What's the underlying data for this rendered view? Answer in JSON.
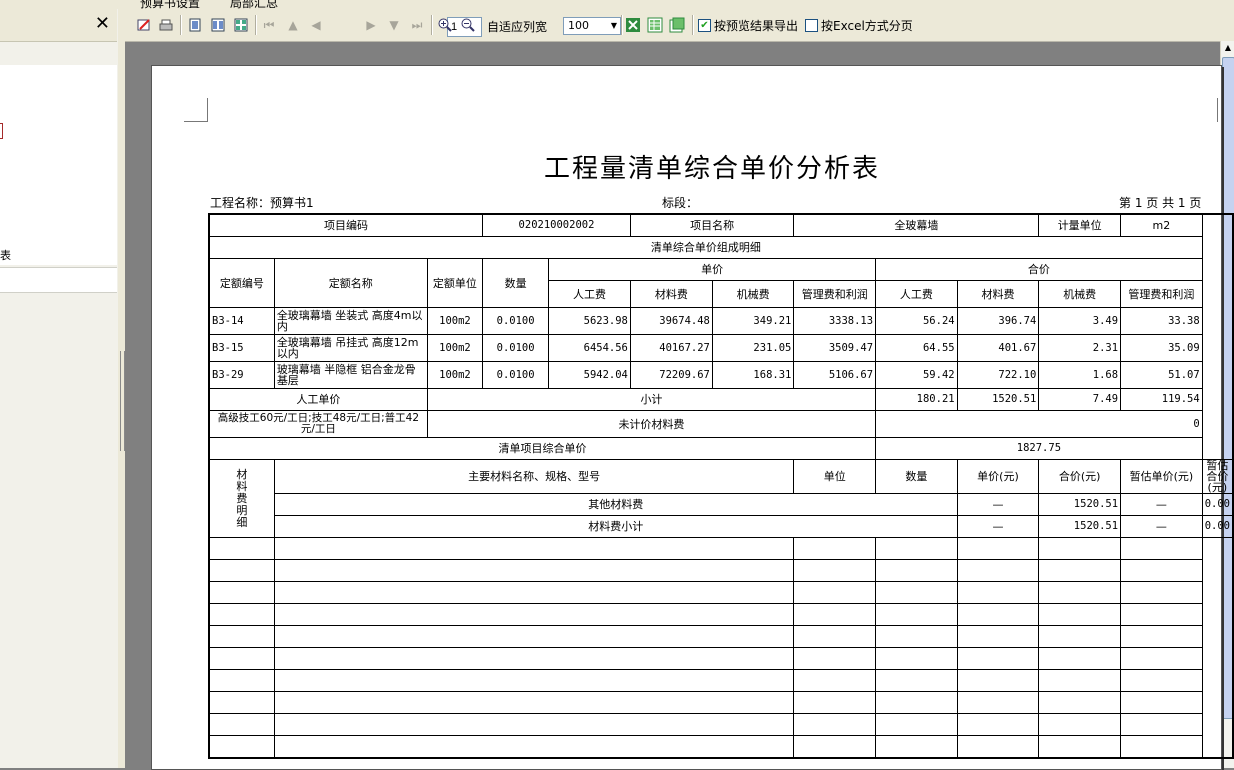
{
  "top_strip": {
    "item1": "预算书设置",
    "item2": "局部汇总"
  },
  "toolbar": {
    "page_number": "1",
    "fit_width_label": "自适应列宽",
    "zoom_value": "100",
    "export_preview_label": "按预览结果导出",
    "excel_paging_label": "按Excel方式分页",
    "export_preview_checked": true,
    "excel_paging_checked": false,
    "icons": [
      "edit-icon",
      "print-icon",
      "single-page-icon",
      "two-page-icon",
      "multi-page-icon",
      "first-page-icon",
      "prev-section-icon",
      "prev-page-icon",
      "next-page-icon",
      "next-section-icon",
      "last-page-icon",
      "zoom-in-icon",
      "zoom-out-icon",
      "excel-export-icon",
      "excel-sheet-icon",
      "excel-multi-icon"
    ]
  },
  "left_panel": {
    "close_label": "✕",
    "item_text": "表"
  },
  "report": {
    "title": "工程量清单综合单价分析表",
    "project_name": "工程名称：预算书1",
    "section": "标段：",
    "page_info": "第 1 页   共 1 页",
    "header": {
      "item_code_label": "项目编码",
      "item_code": "020210002002",
      "item_name_label": "项目名称",
      "item_name": "全玻幕墙",
      "unit_label": "计量单位",
      "unit": "m2"
    },
    "detail_title": "清单综合单价组成明细",
    "cols": {
      "quota_no": "定额编号",
      "quota_name": "定额名称",
      "quota_unit": "定额单位",
      "qty": "数量",
      "unit_price": "单价",
      "total_price": "合价",
      "labor": "人工费",
      "material": "材料费",
      "machine": "机械费",
      "mgmt": "管理费和利润"
    },
    "rows": [
      {
        "no": "B3-14",
        "name": "全玻璃幕墙 坐装式 高度4m以内",
        "unit": "100m2",
        "qty": "0.0100",
        "p_labor": "5623.98",
        "p_mat": "39674.48",
        "p_mach": "349.21",
        "p_mgmt": "3338.13",
        "t_labor": "56.24",
        "t_mat": "396.74",
        "t_mach": "3.49",
        "t_mgmt": "33.38"
      },
      {
        "no": "B3-15",
        "name": "全玻璃幕墙 吊挂式 高度12m以内",
        "unit": "100m2",
        "qty": "0.0100",
        "p_labor": "6454.56",
        "p_mat": "40167.27",
        "p_mach": "231.05",
        "p_mgmt": "3509.47",
        "t_labor": "64.55",
        "t_mat": "401.67",
        "t_mach": "2.31",
        "t_mgmt": "35.09"
      },
      {
        "no": "B3-29",
        "name": "玻璃幕墙 半隐框 铝合金龙骨基层",
        "unit": "100m2",
        "qty": "0.0100",
        "p_labor": "5942.04",
        "p_mat": "72209.67",
        "p_mach": "168.31",
        "p_mgmt": "5106.67",
        "t_labor": "59.42",
        "t_mat": "722.10",
        "t_mach": "1.68",
        "t_mgmt": "51.07"
      }
    ],
    "labor_unit_price_label": "人工单价",
    "labor_rate_text": "高级技工60元/工日;技工48元/工日;普工42元/工日",
    "subtotal_label": "小计",
    "subtotal": {
      "labor": "180.21",
      "mat": "1520.51",
      "mach": "7.49",
      "mgmt": "119.54"
    },
    "unpriced_material_label": "未计价材料费",
    "unpriced_material_value": "0",
    "composite_price_label": "清单项目综合单价",
    "composite_price_value": "1827.75",
    "material_section": {
      "side_label": "材料费明细",
      "name_spec_label": "主要材料名称、规格、型号",
      "unit_label": "单位",
      "qty_label": "数量",
      "unit_price_label": "单价(元)",
      "total_label": "合价(元)",
      "est_unit_label": "暂估单价(元)",
      "est_total_label": "暂估合价(元)",
      "other_label": "其他材料费",
      "other_unit": "—",
      "other_total": "1520.51",
      "other_est_unit": "—",
      "other_est_total": "0.00",
      "subtotal_label": "材料费小计",
      "sub_unit": "—",
      "sub_total": "1520.51",
      "sub_est_unit": "—",
      "sub_est_total": "0.00"
    }
  }
}
